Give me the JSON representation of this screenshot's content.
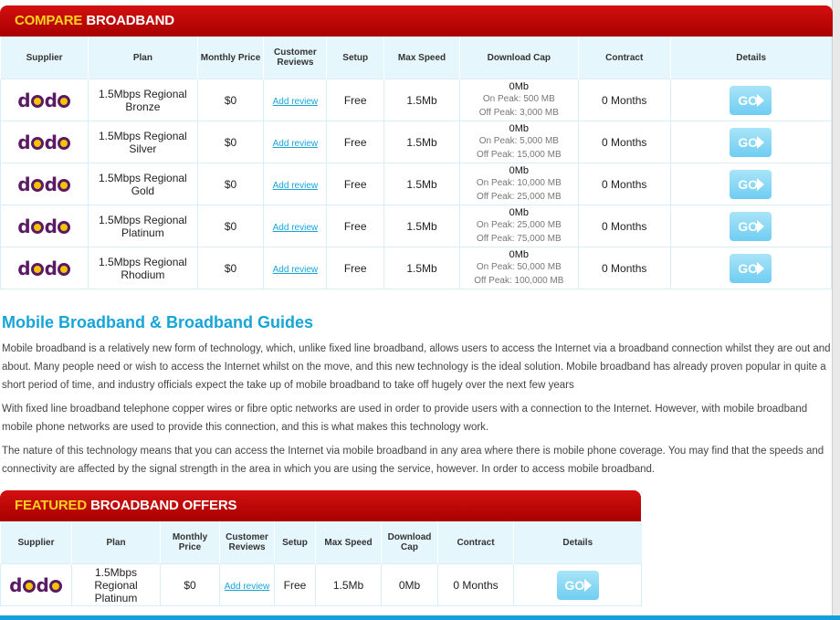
{
  "compare": {
    "title_highlight": "COMPARE",
    "title_rest": "BROADBAND",
    "headers": [
      "Supplier",
      "Plan",
      "Monthly Price",
      "Customer Reviews",
      "Setup",
      "Max Speed",
      "Download Cap",
      "Contract",
      "Details"
    ],
    "rows": [
      {
        "supplier": "dodo",
        "plan": "1.5Mbps Regional Bronze",
        "price": "$0",
        "review": "Add review",
        "setup": "Free",
        "speed": "1.5Mb",
        "cap": "0Mb",
        "peak": "On Peak: 500 MB",
        "offpeak": "Off Peak: 3,000 MB",
        "contract": "0 Months",
        "go": "GO"
      },
      {
        "supplier": "dodo",
        "plan": "1.5Mbps Regional Silver",
        "price": "$0",
        "review": "Add review",
        "setup": "Free",
        "speed": "1.5Mb",
        "cap": "0Mb",
        "peak": "On Peak: 5,000 MB",
        "offpeak": "Off Peak: 15,000 MB",
        "contract": "0 Months",
        "go": "GO"
      },
      {
        "supplier": "dodo",
        "plan": "1.5Mbps Regional Gold",
        "price": "$0",
        "review": "Add review",
        "setup": "Free",
        "speed": "1.5Mb",
        "cap": "0Mb",
        "peak": "On Peak: 10,000 MB",
        "offpeak": "Off Peak: 25,000 MB",
        "contract": "0 Months",
        "go": "GO"
      },
      {
        "supplier": "dodo",
        "plan": "1.5Mbps Regional Platinum",
        "price": "$0",
        "review": "Add review",
        "setup": "Free",
        "speed": "1.5Mb",
        "cap": "0Mb",
        "peak": "On Peak: 25,000 MB",
        "offpeak": "Off Peak: 75,000 MB",
        "contract": "0 Months",
        "go": "GO"
      },
      {
        "supplier": "dodo",
        "plan": "1.5Mbps Regional Rhodium",
        "price": "$0",
        "review": "Add review",
        "setup": "Free",
        "speed": "1.5Mb",
        "cap": "0Mb",
        "peak": "On Peak: 50,000 MB",
        "offpeak": "Off Peak: 100,000 MB",
        "contract": "0 Months",
        "go": "GO"
      }
    ]
  },
  "guides": {
    "heading": "Mobile Broadband & Broadband Guides",
    "paragraphs": [
      "Mobile broadband is a relatively new form of technology, which, unlike fixed line broadband, allows users to access the Internet via a broadband connection whilst they are out and about. Many people need or wish to access the Internet whilst on the move, and this new technology is the ideal solution. Mobile broadband has already proven popular in quite a short period of time, and industry officials expect the take up of mobile broadband to take off hugely over the next few years",
      "With fixed line broadband telephone copper wires or fibre optic networks are used in order to provide users with a connection to the Internet. However, with mobile broadband mobile phone networks are used to provide this connection, and this is what makes this technology work.",
      "The nature of this technology means that you can access the Internet via mobile broadband in any area where there is mobile phone coverage. You may find that the speeds and connectivity are affected by the signal strength in the area in which you are using the service, however. In order to access mobile broadband."
    ]
  },
  "featured": {
    "title_highlight": "FEATURED",
    "title_rest": "BROADBAND OFFERS",
    "headers": [
      "Supplier",
      "Plan",
      "Monthly Price",
      "Customer Reviews",
      "Setup",
      "Max Speed",
      "Download Cap",
      "Contract",
      "Details"
    ],
    "row": {
      "supplier": "dodo",
      "plan": "1.5Mbps Regional Platinum",
      "price": "$0",
      "review": "Add review",
      "setup": "Free",
      "speed": "1.5Mb",
      "cap": "0Mb",
      "contract": "0 Months",
      "go": "GO"
    }
  },
  "colors": {
    "banner_red": "#c40808",
    "highlight_yellow": "#ffd21f",
    "accent_blue": "#16a4d9",
    "header_bg": "#e6f6fd"
  }
}
